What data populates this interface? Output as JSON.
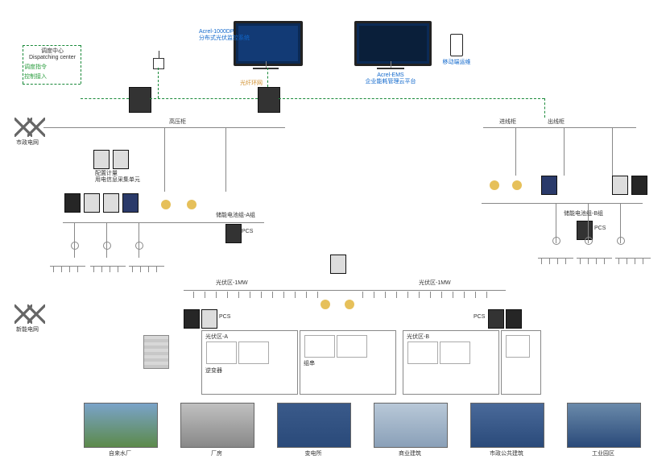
{
  "dispatch": {
    "title": "调度中心",
    "title_en": "Dispatching center",
    "line1": "调度指令",
    "line2": "控制接入"
  },
  "top": {
    "product1_line1": "Acrel-1000DP",
    "product1_line2": "分布式光伏监控系统",
    "product2_line1": "Acrel-EMS",
    "product2_line2": "企业能耗管理云平台",
    "mobile": "移动端运维",
    "gateway_tag": "光纤环网"
  },
  "grid": {
    "left_label": "市政电网",
    "bottom_label": "新能电网",
    "substation_left": "高压柜",
    "substation_right1": "进线柜",
    "substation_right2": "出线柜",
    "meter_note_line1": "配置计量",
    "meter_note_line2": "用电信息采集单元"
  },
  "mid": {
    "pcs": "PCS",
    "box_l": "储能电池组-A组",
    "box_r": "储能电池组-B组",
    "bus_l": "光伏区-1MW",
    "bus_r": "光伏区-1MW",
    "cell_title_l": "光伏区-A",
    "cell_title_r": "光伏区-B",
    "sub_a": "逆变器",
    "sub_b": "组串"
  },
  "photos": {
    "p1": "自来水厂",
    "p2": "厂房",
    "p3": "变电所",
    "p4": "商业建筑",
    "p5": "市政公共建筑",
    "p6": "工业园区"
  },
  "diagram": {
    "type": "system-topology",
    "description": "Acrel distributed PV monitoring + enterprise EMS cloud platform topology. Dispatch center connects via fiber ring to edge gateways; two utility feeds (市政电网 / 新能电网) through HV switchgear into two main distribution sections, each with protection relays, metering, PCS, battery storage groups and 1MW PV string arrays serving six application sites."
  }
}
